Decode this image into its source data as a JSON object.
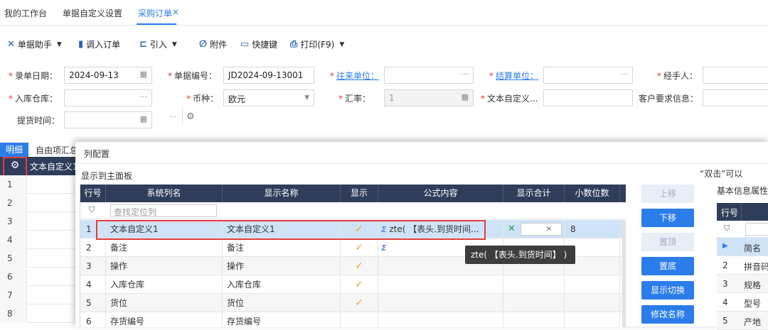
{
  "tabs": [
    {
      "label": "我的工作台"
    },
    {
      "label": "单据自定义设置"
    },
    {
      "label": "采购订单"
    }
  ],
  "tab_close": "×",
  "toolbar": {
    "items": [
      {
        "label": "单据助手",
        "icon": "magic-wand-icon",
        "dropdown": true
      },
      {
        "label": "调入订单",
        "icon": "document-icon",
        "dropdown": false
      },
      {
        "label": "引入",
        "icon": "import-icon",
        "dropdown": true
      },
      {
        "label": "附件",
        "icon": "paperclip-icon",
        "dropdown": false
      },
      {
        "label": "快捷键",
        "icon": "keyboard-icon",
        "dropdown": false
      },
      {
        "label": "打印(F9)",
        "icon": "printer-icon",
        "dropdown": true
      }
    ]
  },
  "form": {
    "date_label": "录单日期：",
    "date_value": "2024-09-13",
    "no_label": "单据编号：",
    "no_value": "JD2024-09-13001",
    "partner_label": "往来单位：",
    "partner_value": "",
    "settle_label": "结算单位：",
    "settle_value": "",
    "handler_label": "经手人：",
    "warehouse_label": "入库仓库：",
    "currency_label": "币种：",
    "currency_value": "欧元",
    "rate_label": "汇率：",
    "rate_value": "1",
    "custom_text_label": "文本自定义...",
    "customer_req_label": "客户要求信息：",
    "pickup_label": "提货时间：",
    "ellipsis": "···"
  },
  "detail_tabs": [
    {
      "label": "明细"
    },
    {
      "label": "自由项汇总"
    }
  ],
  "left_grid": {
    "header_text": "文本自定义1",
    "rows": [
      "1",
      "2",
      "3",
      "4",
      "5",
      "6",
      "7",
      "8"
    ]
  },
  "modal": {
    "title": "列配置",
    "subtitle": "显示到主面板",
    "columns": [
      "行号",
      "系统列名",
      "显示名称",
      "显示",
      "公式内容",
      "显示合计",
      "小数位数"
    ],
    "filter_placeholder": "查找定位列",
    "rows": [
      {
        "no": "1",
        "sys": "文本自定义1",
        "display": "文本自定义1",
        "show": "✓",
        "formula": "zte( 【表头.到货时间...",
        "decimals": "8"
      },
      {
        "no": "2",
        "sys": "备注",
        "display": "备注",
        "show": "✓",
        "formula": "",
        "decimals": ""
      },
      {
        "no": "3",
        "sys": "操作",
        "display": "操作",
        "show": "✓",
        "formula": "",
        "decimals": ""
      },
      {
        "no": "4",
        "sys": "入库仓库",
        "display": "入库仓库",
        "show": "✓",
        "formula": "",
        "decimals": ""
      },
      {
        "no": "5",
        "sys": "货位",
        "display": "货位",
        "show": "✓",
        "formula": "",
        "decimals": ""
      },
      {
        "no": "6",
        "sys": "存货编号",
        "display": "存货编号",
        "show": "",
        "formula": "",
        "decimals": ""
      }
    ],
    "buttons": [
      {
        "label": "上移",
        "disabled": true
      },
      {
        "label": "下移",
        "disabled": false
      },
      {
        "label": "置顶",
        "disabled": true
      },
      {
        "label": "置底",
        "disabled": false
      },
      {
        "label": "显示切换",
        "disabled": false
      },
      {
        "label": "修改名称",
        "disabled": false
      }
    ],
    "right_hint": "“双击”可以",
    "right_title": "基本信息属性",
    "right_header": "行号",
    "right_rows": [
      {
        "no": "▶",
        "name": "简名"
      },
      {
        "no": "2",
        "name": "拼音码"
      },
      {
        "no": "3",
        "name": "规格"
      },
      {
        "no": "4",
        "name": "型号"
      },
      {
        "no": "5",
        "name": "产地"
      }
    ],
    "tooltip": "zte( 【表头.到货时间】 )"
  },
  "colors": {
    "accent": "#2b7de9",
    "header_bg": "#2f3d5a",
    "selected_row": "#cfe3f7",
    "highlight": "#e23b3b"
  }
}
